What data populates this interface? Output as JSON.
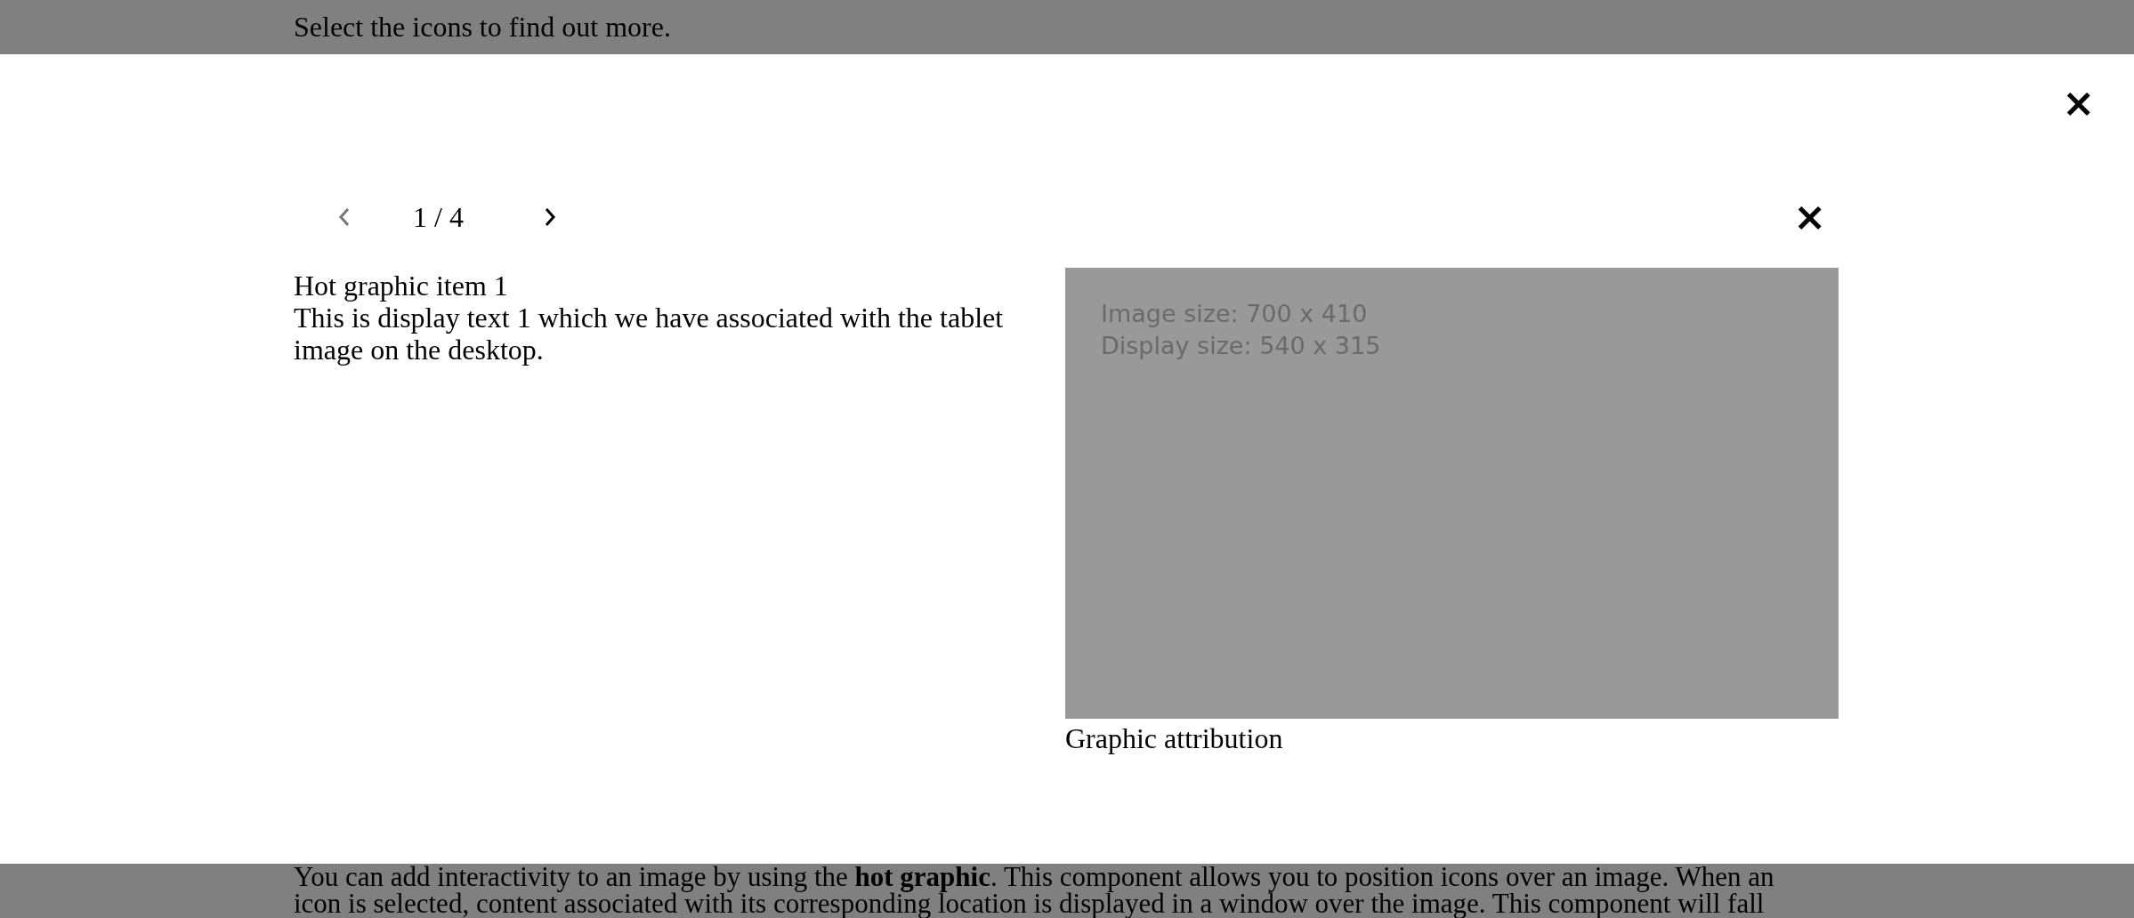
{
  "page": {
    "instruction": "Select the icons to find out more.",
    "paragraph": "You can add interactivity to an image by using the **hot graphic**. This component allows you to position icons over an image. When an icon is selected, content associated with its corresponding location is displayed in a window over the image. This component will fall"
  },
  "modal": {
    "close": "×",
    "pager": {
      "prev": {
        "disabled": true
      },
      "position": "1 / 4",
      "next": {
        "disabled": false
      }
    },
    "item_close": "×",
    "item": {
      "title": "Hot graphic item 1",
      "body": "This is display text 1 which we have associated with the tablet image on the desktop."
    },
    "image": {
      "lines": [
        "Image size: 700 x 410",
        "Display size: 540 x 315"
      ],
      "attribution": "Graphic attribution"
    }
  }
}
